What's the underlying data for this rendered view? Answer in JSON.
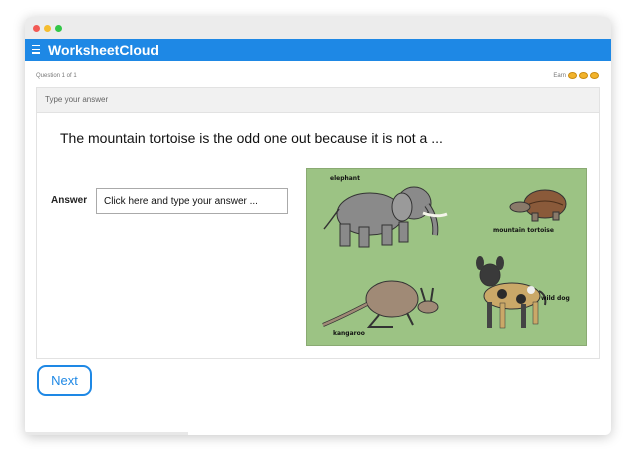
{
  "app": {
    "title": "WorksheetCloud"
  },
  "question_meta": {
    "counter": "Question 1 of 1",
    "earn_label": "Earn",
    "coin_count": 3
  },
  "card": {
    "header": "Type your answer",
    "question": "The mountain tortoise is the odd one out because it is not a ...",
    "answer_label": "Answer",
    "answer_placeholder": "Click here and type your answer ...",
    "answer_value": ""
  },
  "image": {
    "labels": {
      "elephant": "elephant",
      "tortoise": "mountain tortoise",
      "kangaroo": "kangaroo",
      "wild_dog": "wild dog"
    },
    "background": "#9cc384"
  },
  "actions": {
    "next_label": "Next"
  },
  "colors": {
    "brand": "#1e88e5",
    "coin": "#f2b32b"
  }
}
